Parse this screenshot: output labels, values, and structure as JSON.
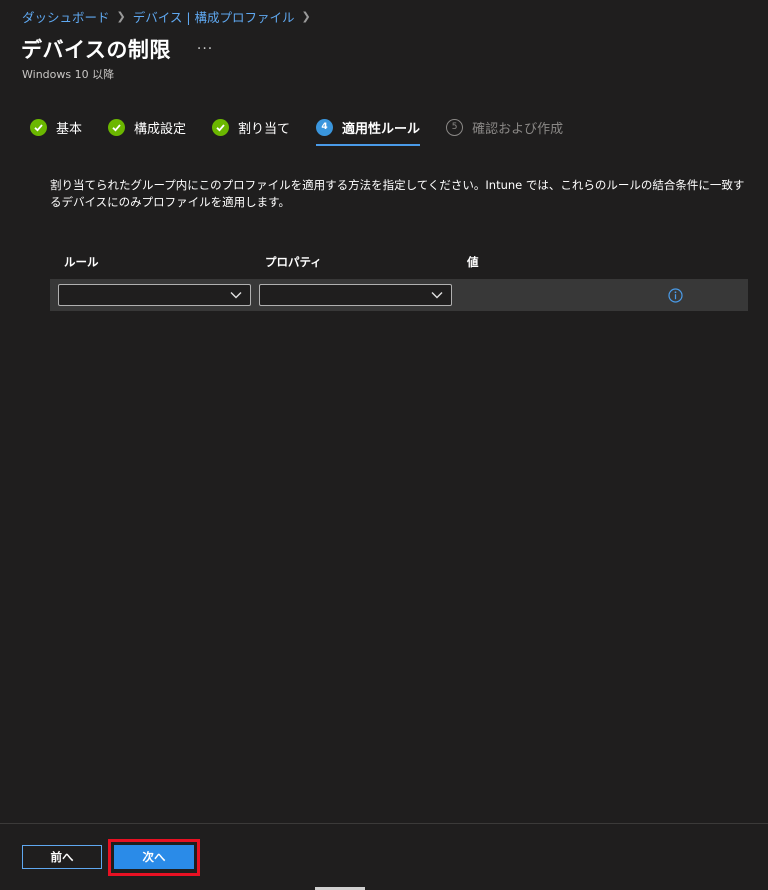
{
  "breadcrumb": {
    "items": [
      "ダッシュボード",
      "デバイス | 構成プロファイル"
    ]
  },
  "header": {
    "title": "デバイスの制限",
    "more": "···",
    "subtitle": "Windows 10 以降"
  },
  "steps": [
    {
      "label": "基本",
      "status": "done"
    },
    {
      "label": "構成設定",
      "status": "done"
    },
    {
      "label": "割り当て",
      "status": "done"
    },
    {
      "label": "適用性ルール",
      "status": "current",
      "number": "4"
    },
    {
      "label": "確認および作成",
      "status": "pending",
      "number": "5"
    }
  ],
  "description": "割り当てられたグループ内にこのプロファイルを適用する方法を指定してください。Intune では、これらのルールの結合条件に一致するデバイスにのみプロファイルを適用します。",
  "table": {
    "columns": [
      "ルール",
      "プロパティ",
      "値"
    ],
    "row": {
      "rule": "",
      "property": "",
      "value": ""
    }
  },
  "footer": {
    "prev_label": "前へ",
    "next_label": "次へ"
  },
  "colors": {
    "accent": "#2a8be8",
    "link": "#5fa8f0",
    "done": "#6bb700",
    "highlight": "#e81123"
  }
}
